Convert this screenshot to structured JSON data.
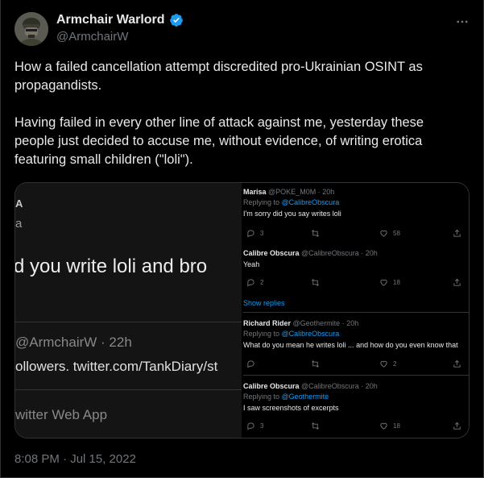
{
  "author": {
    "display_name": "Armchair Warlord",
    "handle": "@ArmchairW",
    "verified": true,
    "avatar_icon": "soldier-avatar-icon"
  },
  "tweet": {
    "paragraph1": "How a failed cancellation attempt discredited pro-Ukrainian OSINT as propagandists.",
    "paragraph2": "Having failed in every other line of attack against me, yesterday these people just decided to accuse me, without evidence, of writing erotica featuring small children (\"loli\").",
    "timestamp": "8:08 PM · Jul 15, 2022"
  },
  "media": {
    "left_image": {
      "line_a": "A",
      "line_a2": "a",
      "quote": "d you write loli and bro",
      "handle_time": "@ArmchairW · 22h",
      "link": "ollowers. twitter.com/TankDiary/st",
      "app": "witter Web App"
    },
    "right_image": {
      "replies": [
        {
          "name": "Marisa",
          "meta": "@POKE_M0M · 20h",
          "replying_prefix": "Replying to ",
          "replying_to": "@CalibreObscura",
          "body": "I'm sorry did you say writes loli",
          "reply_count": "3",
          "retweet_count": "",
          "like_count": "58"
        },
        {
          "name": "Calibre Obscura",
          "meta": "@CalibreObscura · 20h",
          "body": "Yeah",
          "reply_count": "2",
          "retweet_count": "",
          "like_count": "18"
        },
        {
          "name": "Richard Rider",
          "meta": "@Geothermite · 20h",
          "replying_prefix": "Replying to ",
          "replying_to": "@CalibreObscura",
          "body": "What do you mean he writes loli ... and how do you even know that",
          "reply_count": "",
          "retweet_count": "",
          "like_count": "2"
        },
        {
          "name": "Calibre Obscura",
          "meta": "@CalibreObscura · 20h",
          "replying_prefix": "Replying to ",
          "replying_to": "@Geothermite",
          "body": "I saw screenshots of excerpts",
          "reply_count": "3",
          "retweet_count": "",
          "like_count": "18"
        }
      ],
      "show_replies": "Show replies"
    }
  },
  "colors": {
    "background": "#000000",
    "text": "#e7e9ea",
    "secondary": "#71767b",
    "accent": "#1d9bf0",
    "border": "#2f3336"
  }
}
